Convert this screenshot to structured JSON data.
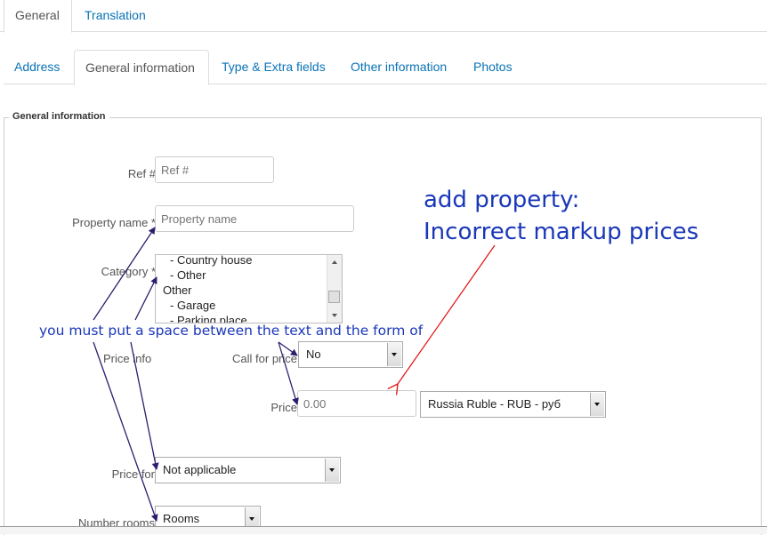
{
  "tabs_top": [
    {
      "label": "General",
      "active": true
    },
    {
      "label": "Translation",
      "active": false
    }
  ],
  "tabs_sub": [
    {
      "label": "Address",
      "active": false
    },
    {
      "label": "General information",
      "active": true
    },
    {
      "label": "Type & Extra fields",
      "active": false
    },
    {
      "label": "Other information",
      "active": false
    },
    {
      "label": "Photos",
      "active": false
    }
  ],
  "fieldset": {
    "legend": "General information",
    "ref": {
      "label": "Ref #",
      "placeholder": "Ref #"
    },
    "property_name": {
      "label": "Property name *",
      "placeholder": "Property name"
    },
    "category": {
      "label": "Category *",
      "options": [
        {
          "text": "- Country house",
          "sub": true
        },
        {
          "text": "- Other",
          "sub": true
        },
        {
          "text": "Other",
          "sub": false
        },
        {
          "text": "- Garage",
          "sub": true
        },
        {
          "text": "- Parking place",
          "sub": true
        }
      ]
    },
    "price_info": {
      "label": "Price info"
    },
    "call_for_price": {
      "label": "Call for price",
      "value": "No"
    },
    "price": {
      "label": "Price",
      "placeholder": "0.00",
      "currency": "Russia Ruble - RUB - руб"
    },
    "price_for": {
      "label": "Price for",
      "value": "Not applicable"
    },
    "number_rooms": {
      "label": "Number rooms",
      "value": "Rooms"
    }
  },
  "annotations": {
    "title_line1": "add property:",
    "title_line2": "Incorrect markup prices",
    "note": "you must put a space between the text and the form of",
    "colors": {
      "blue": "#1a37b8",
      "red": "#e01010",
      "dark_arrow": "#2a1f6e"
    }
  }
}
